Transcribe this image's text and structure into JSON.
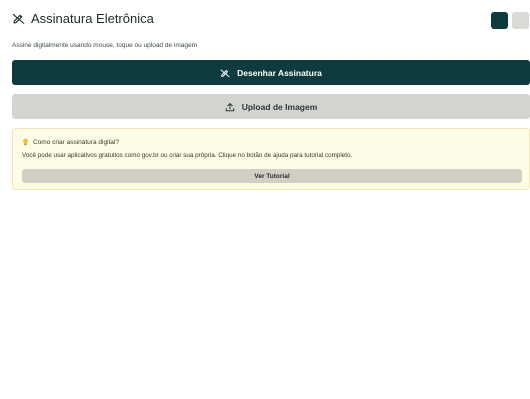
{
  "header": {
    "title": "Assinatura Eletrônica",
    "icon": "signature-pen-icon"
  },
  "subtitle": "Assine digitalmente usando mouse, toque ou upload de imagem",
  "actions": {
    "draw_label": "Desenhar Assinatura",
    "draw_icon": "signature-pen-icon",
    "upload_label": "Upload de Imagem",
    "upload_icon": "upload-icon"
  },
  "tip": {
    "icon": "lightbulb-icon",
    "title": "Como criar assinatura digital?",
    "text": "Você pode usar aplicativos gratuitos como gov.br ou criar sua própria. Clique no botão de ajuda para tutorial completo.",
    "button_label": "Ver Tutorial"
  },
  "colors": {
    "primary": "#0e3b3e",
    "secondary": "#d3d3cf",
    "tip_background": "#fefbe6",
    "tip_border": "#f2e6b8"
  }
}
